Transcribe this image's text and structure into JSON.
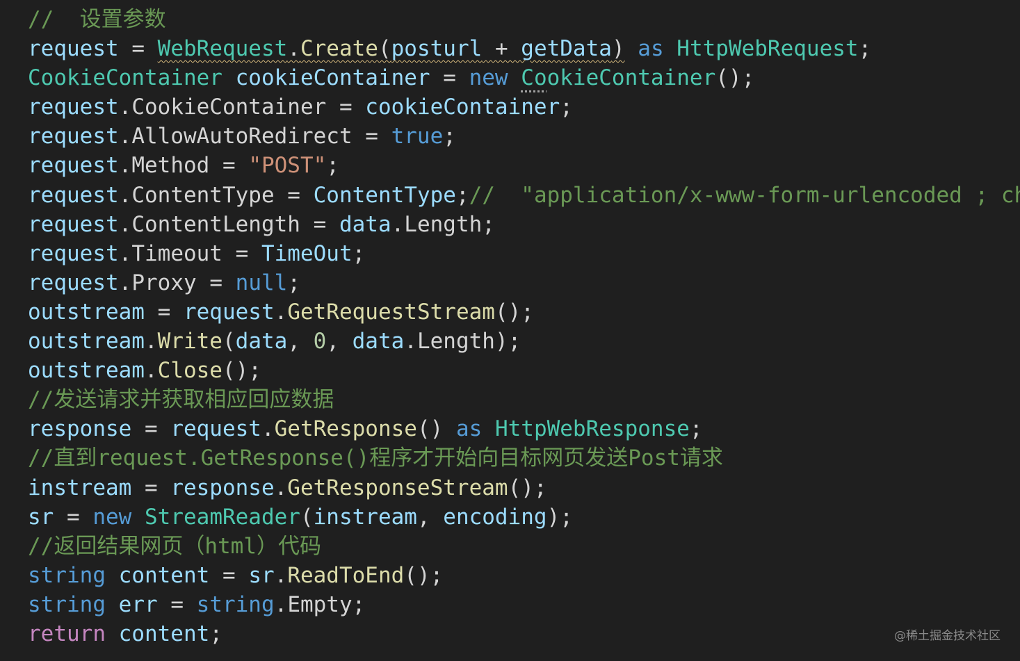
{
  "colors": {
    "background": "#1f1f1f",
    "variable": "#9cdcfe",
    "type": "#4ec9b0",
    "keyword": "#569cd6",
    "control": "#c586c0",
    "function": "#dcdcaa",
    "plain": "#d4d4d4",
    "string": "#ce9178",
    "number": "#b5cea8",
    "comment": "#6a9955",
    "warning_squiggle": "#d7ba7d"
  },
  "lines": [
    [
      {
        "t": "//  设置参数",
        "c": "cm"
      }
    ],
    [
      {
        "t": "request",
        "c": "var"
      },
      {
        "t": " = ",
        "c": "op"
      },
      {
        "t": "WebRequest",
        "c": "type",
        "u": "squiggle"
      },
      {
        "t": ".",
        "c": "pn",
        "u": "squiggle"
      },
      {
        "t": "Create",
        "c": "fn",
        "u": "squiggle"
      },
      {
        "t": "(",
        "c": "pn",
        "u": "squiggle"
      },
      {
        "t": "posturl",
        "c": "var",
        "u": "squiggle"
      },
      {
        "t": " + ",
        "c": "op",
        "u": "squiggle"
      },
      {
        "t": "getData",
        "c": "var",
        "u": "squiggle"
      },
      {
        "t": ")",
        "c": "pn",
        "u": "squiggle"
      },
      {
        "t": " ",
        "c": "pn"
      },
      {
        "t": "as",
        "c": "kw"
      },
      {
        "t": " ",
        "c": "pn"
      },
      {
        "t": "HttpWebRequest",
        "c": "type"
      },
      {
        "t": ";",
        "c": "pn"
      }
    ],
    [
      {
        "t": "CookieContainer",
        "c": "type"
      },
      {
        "t": " ",
        "c": "pn"
      },
      {
        "t": "cookieContainer",
        "c": "var"
      },
      {
        "t": " = ",
        "c": "op"
      },
      {
        "t": "new",
        "c": "kw"
      },
      {
        "t": " ",
        "c": "pn"
      },
      {
        "t": "Co",
        "c": "type",
        "u": "dotted"
      },
      {
        "t": "okieContainer",
        "c": "type"
      },
      {
        "t": "();",
        "c": "pn"
      }
    ],
    [
      {
        "t": "request",
        "c": "var"
      },
      {
        "t": ".",
        "c": "pn"
      },
      {
        "t": "CookieContainer",
        "c": "prop"
      },
      {
        "t": " = ",
        "c": "op"
      },
      {
        "t": "cookieContainer",
        "c": "var"
      },
      {
        "t": ";",
        "c": "pn"
      }
    ],
    [
      {
        "t": "request",
        "c": "var"
      },
      {
        "t": ".",
        "c": "pn"
      },
      {
        "t": "AllowAutoRedirect",
        "c": "prop"
      },
      {
        "t": " = ",
        "c": "op"
      },
      {
        "t": "true",
        "c": "kw"
      },
      {
        "t": ";",
        "c": "pn"
      }
    ],
    [
      {
        "t": "request",
        "c": "var"
      },
      {
        "t": ".",
        "c": "pn"
      },
      {
        "t": "Method",
        "c": "prop"
      },
      {
        "t": " = ",
        "c": "op"
      },
      {
        "t": "\"POST\"",
        "c": "str"
      },
      {
        "t": ";",
        "c": "pn"
      }
    ],
    [
      {
        "t": "request",
        "c": "var"
      },
      {
        "t": ".",
        "c": "pn"
      },
      {
        "t": "ContentType",
        "c": "prop"
      },
      {
        "t": " = ",
        "c": "op"
      },
      {
        "t": "ContentType",
        "c": "var"
      },
      {
        "t": ";",
        "c": "pn"
      },
      {
        "t": "//  \"application/x-www-form-urlencoded ; ch",
        "c": "cm"
      }
    ],
    [
      {
        "t": "request",
        "c": "var"
      },
      {
        "t": ".",
        "c": "pn"
      },
      {
        "t": "ContentLength",
        "c": "prop"
      },
      {
        "t": " = ",
        "c": "op"
      },
      {
        "t": "data",
        "c": "var"
      },
      {
        "t": ".",
        "c": "pn"
      },
      {
        "t": "Length",
        "c": "prop"
      },
      {
        "t": ";",
        "c": "pn"
      }
    ],
    [
      {
        "t": "request",
        "c": "var"
      },
      {
        "t": ".",
        "c": "pn"
      },
      {
        "t": "Timeout",
        "c": "prop"
      },
      {
        "t": " = ",
        "c": "op"
      },
      {
        "t": "TimeOut",
        "c": "var"
      },
      {
        "t": ";",
        "c": "pn"
      }
    ],
    [
      {
        "t": "request",
        "c": "var"
      },
      {
        "t": ".",
        "c": "pn"
      },
      {
        "t": "Proxy",
        "c": "prop"
      },
      {
        "t": " = ",
        "c": "op"
      },
      {
        "t": "null",
        "c": "kw"
      },
      {
        "t": ";",
        "c": "pn"
      }
    ],
    [
      {
        "t": "outstream",
        "c": "var"
      },
      {
        "t": " = ",
        "c": "op"
      },
      {
        "t": "request",
        "c": "var"
      },
      {
        "t": ".",
        "c": "pn"
      },
      {
        "t": "GetRequestStream",
        "c": "fn"
      },
      {
        "t": "();",
        "c": "pn"
      }
    ],
    [
      {
        "t": "outstream",
        "c": "var"
      },
      {
        "t": ".",
        "c": "pn"
      },
      {
        "t": "Write",
        "c": "fn"
      },
      {
        "t": "(",
        "c": "pn"
      },
      {
        "t": "data",
        "c": "var"
      },
      {
        "t": ", ",
        "c": "pn"
      },
      {
        "t": "0",
        "c": "num"
      },
      {
        "t": ", ",
        "c": "pn"
      },
      {
        "t": "data",
        "c": "var"
      },
      {
        "t": ".",
        "c": "pn"
      },
      {
        "t": "Length",
        "c": "prop"
      },
      {
        "t": ");",
        "c": "pn"
      }
    ],
    [
      {
        "t": "outstream",
        "c": "var"
      },
      {
        "t": ".",
        "c": "pn"
      },
      {
        "t": "Close",
        "c": "fn"
      },
      {
        "t": "();",
        "c": "pn"
      }
    ],
    [
      {
        "t": "//发送请求并获取相应回应数据",
        "c": "cm"
      }
    ],
    [
      {
        "t": "response",
        "c": "var"
      },
      {
        "t": " = ",
        "c": "op"
      },
      {
        "t": "request",
        "c": "var"
      },
      {
        "t": ".",
        "c": "pn"
      },
      {
        "t": "GetResponse",
        "c": "fn"
      },
      {
        "t": "() ",
        "c": "pn"
      },
      {
        "t": "as",
        "c": "kw"
      },
      {
        "t": " ",
        "c": "pn"
      },
      {
        "t": "HttpWebResponse",
        "c": "type"
      },
      {
        "t": ";",
        "c": "pn"
      }
    ],
    [
      {
        "t": "//直到request.GetResponse()程序才开始向目标网页发送Post请求",
        "c": "cm"
      }
    ],
    [
      {
        "t": "instream",
        "c": "var"
      },
      {
        "t": " = ",
        "c": "op"
      },
      {
        "t": "response",
        "c": "var"
      },
      {
        "t": ".",
        "c": "pn"
      },
      {
        "t": "GetResponseStream",
        "c": "fn"
      },
      {
        "t": "();",
        "c": "pn"
      }
    ],
    [
      {
        "t": "sr",
        "c": "var"
      },
      {
        "t": " = ",
        "c": "op"
      },
      {
        "t": "new",
        "c": "kw"
      },
      {
        "t": " ",
        "c": "pn"
      },
      {
        "t": "StreamReader",
        "c": "type"
      },
      {
        "t": "(",
        "c": "pn"
      },
      {
        "t": "instream",
        "c": "var"
      },
      {
        "t": ", ",
        "c": "pn"
      },
      {
        "t": "encoding",
        "c": "var"
      },
      {
        "t": ");",
        "c": "pn"
      }
    ],
    [
      {
        "t": "//返回结果网页（html）代码",
        "c": "cm"
      }
    ],
    [
      {
        "t": "string",
        "c": "kw"
      },
      {
        "t": " ",
        "c": "pn"
      },
      {
        "t": "content",
        "c": "var"
      },
      {
        "t": " = ",
        "c": "op"
      },
      {
        "t": "sr",
        "c": "var"
      },
      {
        "t": ".",
        "c": "pn"
      },
      {
        "t": "ReadToEnd",
        "c": "fn"
      },
      {
        "t": "();",
        "c": "pn"
      }
    ],
    [
      {
        "t": "string",
        "c": "kw"
      },
      {
        "t": " ",
        "c": "pn"
      },
      {
        "t": "err",
        "c": "var"
      },
      {
        "t": " = ",
        "c": "op"
      },
      {
        "t": "string",
        "c": "kw"
      },
      {
        "t": ".",
        "c": "pn"
      },
      {
        "t": "Empty",
        "c": "prop"
      },
      {
        "t": ";",
        "c": "pn"
      }
    ],
    [
      {
        "t": "return",
        "c": "ctrl"
      },
      {
        "t": " ",
        "c": "pn"
      },
      {
        "t": "content",
        "c": "var"
      },
      {
        "t": ";",
        "c": "pn"
      }
    ]
  ],
  "watermark": "@稀土掘金技术社区"
}
